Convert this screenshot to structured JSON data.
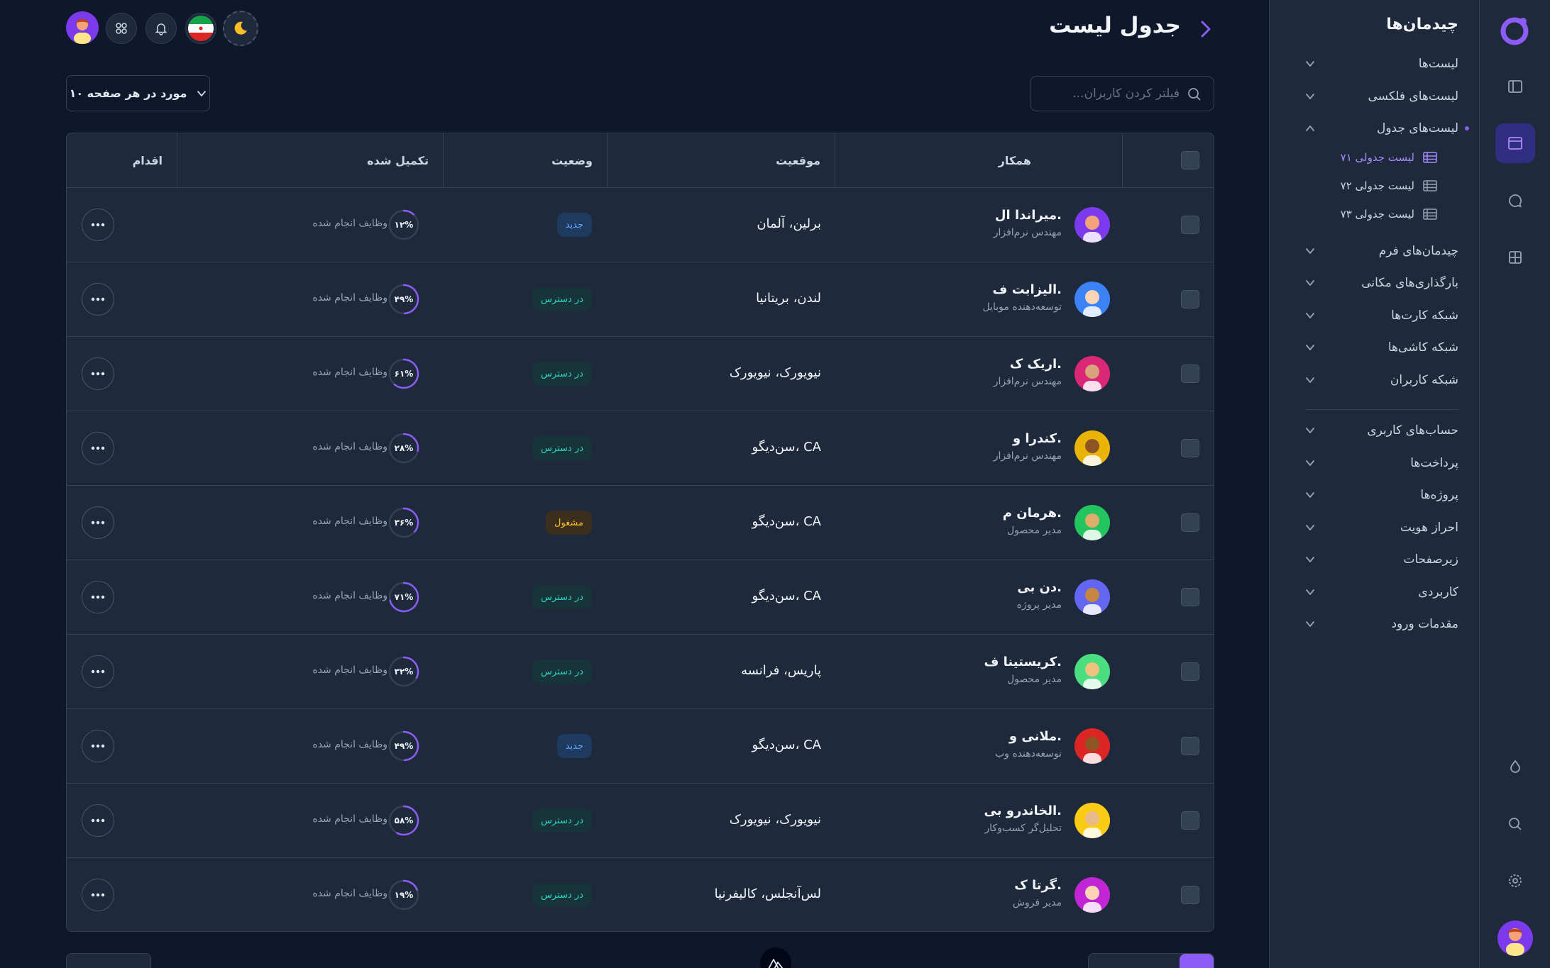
{
  "header": {
    "title": "جدول لیست",
    "language": "فارسی"
  },
  "sidebar": {
    "title": "چیدمان‌ها",
    "items": [
      {
        "label": "لیست‌ها"
      },
      {
        "label": "لیست‌های فلکسی"
      },
      {
        "label": "لیست‌های جدول",
        "expanded": true
      },
      {
        "label": "چیدمان‌های فرم"
      },
      {
        "label": "بارگذاری‌های مکانی"
      },
      {
        "label": "شبکه کارت‌ها"
      },
      {
        "label": "شبکه کاشی‌ها"
      },
      {
        "label": "شبکه کاربران"
      }
    ],
    "subitems": [
      {
        "label": "لیست جدولی ۷۱",
        "active": true
      },
      {
        "label": "لیست جدولی ۷۲"
      },
      {
        "label": "لیست جدولی ۷۳"
      }
    ],
    "items2": [
      {
        "label": "حساب‌های کاربری"
      },
      {
        "label": "پرداخت‌ها"
      },
      {
        "label": "پروژه‌ها"
      },
      {
        "label": "احراز هویت"
      },
      {
        "label": "زیرصفحات"
      },
      {
        "label": "کاربردی"
      },
      {
        "label": "مقدمات ورود"
      }
    ]
  },
  "toolbar": {
    "search_placeholder": "فیلتر کردن کاربران...",
    "per_page": "۱۰ مورد در هر صفحه"
  },
  "table": {
    "columns": {
      "colleague": "همکار",
      "location": "موقعیت",
      "status": "وضعیت",
      "completed": "تکمیل شده",
      "action": "اقدام"
    },
    "rows": [
      {
        "name": "میراندا ال.",
        "role": "مهندس نرم‌افزار",
        "location": "برلین، آلمان",
        "status": "جدید",
        "status_kind": "new",
        "percent": 12,
        "percent_label": "۱۲%",
        "task": "وظایف انجام شده",
        "avatar_color": "#7c3aed"
      },
      {
        "name": "الیزابت ف.",
        "role": "توسعه‌دهنده موبایل",
        "location": "لندن، بریتانیا",
        "status": "در دسترس",
        "status_kind": "available",
        "percent": 49,
        "percent_label": "۴۹%",
        "task": "وظایف انجام شده",
        "avatar_color": "#3b82f6"
      },
      {
        "name": "اریک ک.",
        "role": "مهندس نرم‌افزار",
        "location": "نیویورک، نیویورک",
        "status": "در دسترس",
        "status_kind": "available",
        "percent": 61,
        "percent_label": "۶۱%",
        "task": "وظایف انجام شده",
        "avatar_color": "#db2777"
      },
      {
        "name": "کندرا و.",
        "role": "مهندس نرم‌افزار",
        "location": "سن‌دیگو، CA",
        "status": "در دسترس",
        "status_kind": "available",
        "percent": 28,
        "percent_label": "۲۸%",
        "task": "وظایف انجام شده",
        "avatar_color": "#eab308"
      },
      {
        "name": "هرمان م.",
        "role": "مدیر محصول",
        "location": "سن‌دیگو، CA",
        "status": "مشغول",
        "status_kind": "busy",
        "percent": 36,
        "percent_label": "۳۶%",
        "task": "وظایف انجام شده",
        "avatar_color": "#22c55e"
      },
      {
        "name": "دن بی.",
        "role": "مدیر پروژه",
        "location": "سن‌دیگو، CA",
        "status": "در دسترس",
        "status_kind": "available",
        "percent": 71,
        "percent_label": "۷۱%",
        "task": "وظایف انجام شده",
        "avatar_color": "#6366f1"
      },
      {
        "name": "کریستینا ف.",
        "role": "مدیر محصول",
        "location": "پاریس، فرانسه",
        "status": "در دسترس",
        "status_kind": "available",
        "percent": 32,
        "percent_label": "۳۲%",
        "task": "وظایف انجام شده",
        "avatar_color": "#4ade80"
      },
      {
        "name": "ملانی و.",
        "role": "توسعه‌دهنده وب",
        "location": "سن‌دیگو، CA",
        "status": "جدید",
        "status_kind": "new",
        "percent": 49,
        "percent_label": "۴۹%",
        "task": "وظایف انجام شده",
        "avatar_color": "#dc2626"
      },
      {
        "name": "الخاندرو بی.",
        "role": "تحلیل‌گر کسب‌وکار",
        "location": "نیویورک، نیویورک",
        "status": "در دسترس",
        "status_kind": "available",
        "percent": 58,
        "percent_label": "۵۸%",
        "task": "وظایف انجام شده",
        "avatar_color": "#facc15"
      },
      {
        "name": "گرتا ک.",
        "role": "مدیر فروش",
        "location": "لس‌آنجلس، کالیفرنیا",
        "status": "در دسترس",
        "status_kind": "available",
        "percent": 19,
        "percent_label": "۱۹%",
        "task": "وظایف انجام شده",
        "avatar_color": "#c026d3"
      }
    ]
  },
  "colors": {
    "accent": "#8b5cf6",
    "background": "#0f172a",
    "surface": "#1e293b",
    "border": "#334155"
  }
}
